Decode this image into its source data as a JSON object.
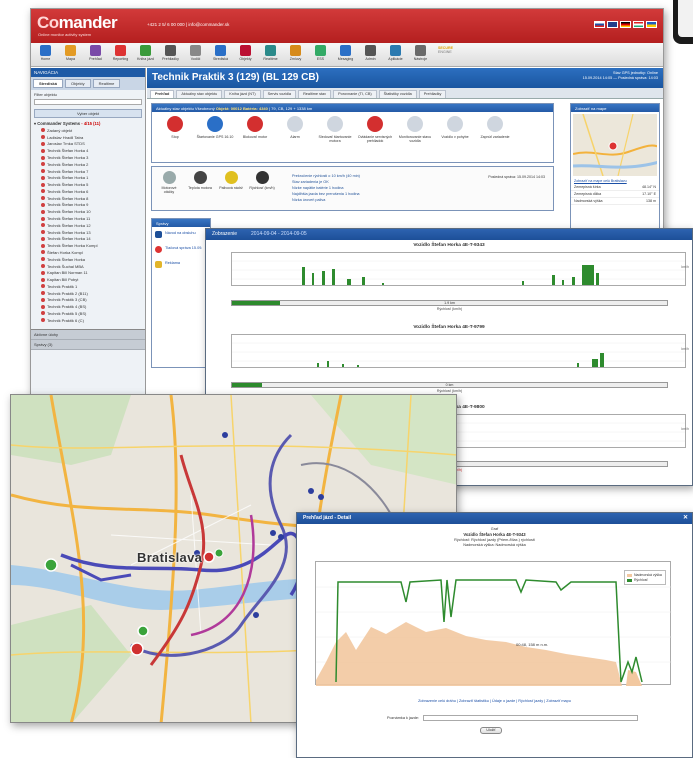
{
  "app": {
    "logo_main": "Co",
    "logo_accent": "mander",
    "logo_sub": "Online monitor activity system",
    "contact": "+421 2 5/ 6 00 000 | info@commander.sk"
  },
  "toolbar": {
    "items": [
      "Home",
      "Mapa",
      "Prehľad",
      "Reporting",
      "Kniha jázd",
      "Prehliadky",
      "Vodiči",
      "Strediská",
      "Objekty",
      "Realtime",
      "Zmluvy",
      "ESS",
      "Mesaging",
      "Admin",
      "Aplikácie",
      "Nástroje"
    ],
    "special": [
      "SECURE",
      "ENGINE"
    ]
  },
  "sidebar": {
    "header": "NAVIGÁCIA",
    "tabs": [
      "Strediská",
      "Objekty",
      "Realtime"
    ],
    "filter_label": "Filter objektu",
    "select_label": "Vyber objekt",
    "root": "Commander Systems",
    "root_count": "- 4/15 (11)",
    "items": [
      "Zadaný objekt",
      "Ladislav Hradil Tatra",
      "Jaroslav Trnka STDS",
      "Technik Štefan Horka 4",
      "Technik Štefan Horka 3",
      "Technik Štefan Horka 2",
      "Technik Štefan Horka 7",
      "Technik Štefan Horka 1",
      "Technik Štefan Horka 5",
      "Technik Štefan Horka 6",
      "Technik Štefan Horka 8",
      "Technik Štefan Horka 9",
      "Technik Štefan Horka 10",
      "Technik Štefan Horka 11",
      "Technik Štefan Horka 12",
      "Technik Štefan Horka 13",
      "Technik Štefan Horka 14",
      "Technik Štefan Horka Kompl",
      "Štefan Horka Kompl",
      "Technik Štefan Horka",
      "Technik Šuchal MBA",
      "Kapitan Bill Norman 11",
      "Kapitan Bill Pobyt",
      "Technik Praktik 1",
      "Technik Praktik 2 (B11)",
      "Technik Praktik 3 (CB)",
      "Technik Praktik 4 (BS)",
      "Technik Praktik 5 (BS)",
      "Technik Praktik 6 (C)"
    ],
    "footer": [
      "Aktívne úlohy",
      "Správy (3)"
    ]
  },
  "page": {
    "title": "Technik Praktik 3 (129) (BL 129 CB)",
    "info_line1": "Stav GPS jednotky: Online",
    "info_line2": "15.09.2014 14:05 — Posledná správa: 14:03",
    "tabs": [
      "Prehľad",
      "Aktuálny stav objektu",
      "Kniha jázd (NT)",
      "Servis vozidla",
      "Realtime stav",
      "Porovnanie (TI, CB)",
      "Štatistiky vozidla",
      "Prehliadky"
    ]
  },
  "panel_control": {
    "header_text": "Aktuálny stav objektu Všeobecný",
    "header_b1": "Objekt: 00012",
    "header_b2": "Batéria: 4340",
    "header_rest": "| 79, CB, 129 + 1338 km",
    "items": [
      "Stop",
      "Štartovanie GPS 16.10",
      "Blokovať motor",
      "Alarm",
      "Sledovať štartovanie motora",
      "Ovládanie servisných prehliadok",
      "Monitorovanie stavu vozidla",
      "Vozidlo v pohybe",
      "Zapnúť zariadenie"
    ]
  },
  "panel_status": {
    "gauges": [
      "Motorové otáčky",
      "Teplota motora",
      "Palivová nádrž",
      "Rýchlosť (km/h)"
    ],
    "news": [
      "Prekročenie rýchlosti o 10 km/h (40 min)",
      "Stav zariadenia je OK",
      "Nízke napätie batérie 1 hodina",
      "Najdlhšia jazda bez prerušenia 1 hodina",
      "Nízka úroveň paliva"
    ],
    "right_text": "Posledná správa: 15.09.2014 14:03"
  },
  "map_panel": {
    "header": "Zobraziť na mape",
    "link": "Zobraziť na mape celú Bratislavu",
    "rows": [
      {
        "k": "Zemepisná šírka",
        "v": "48.14° N"
      },
      {
        "k": "Zemepisná dĺžka",
        "v": "17.10° E"
      },
      {
        "k": "Nadmorská výška",
        "v": "138 m"
      }
    ]
  },
  "panel_left": {
    "header": "Správy",
    "items": [
      "Návod na obsluhu",
      "Tlačová správa 15.09.",
      "Reklama"
    ]
  },
  "chart_window": {
    "title": "Zobrazenie",
    "date_range": "2014-09-04 - 2014-09-05",
    "charts": [
      {
        "title": "Vozidlo Štefan Horka 4E-T-9343",
        "bar_label": "1.9 km",
        "caption": "Rýchlosť (km/h)",
        "side_label": "km/h"
      },
      {
        "title": "Vozidlo Štefan Horka 4E-T-9799",
        "bar_label": "0 km",
        "caption": "Rýchlosť (km/h)",
        "side_label": "km/h"
      },
      {
        "title": "Vozidlo Štefan Horka 4E-T-9800",
        "bar_label": "",
        "caption": "Rýchlosť (km/h)",
        "side_label": "km/h"
      }
    ]
  },
  "map_window": {
    "city_label": "Bratislava"
  },
  "detail_window": {
    "title": "Prehľad jázd - Detail",
    "h0": "Graf",
    "h1": "Vozidlo Štefan Horka 4E-T-9343",
    "h2": "Rýchlosť: Rýchlosť jazdy (Priem./Max.) rýchlosti",
    "h3": "Nadmorská výška: Nadmorská výška",
    "legend": [
      "Nadmorská výška",
      "Rýchlosť"
    ],
    "point_label": "00:48, 158 m n.m.",
    "links": "Zobrazenie celú dráhu | Zobraziť štatistiku | Údaje o jazde | Rýchlosť jazdy | Zobraziť mapu",
    "form_label": "Poznámka k jazde:",
    "button_label": "Uložiť"
  },
  "colors": {
    "brand_red": "#c62828",
    "header_blue": "#1d56a2",
    "speed_green": "#2e8b2e",
    "elevation": "#f2c8a0"
  }
}
